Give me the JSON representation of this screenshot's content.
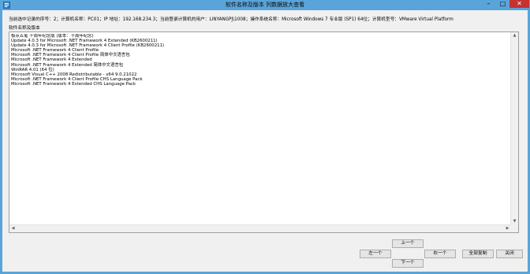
{
  "window": {
    "title": "软件名称及版本 列数据放大查看",
    "minimize_glyph": "–",
    "maximize_glyph": "□",
    "close_glyph": "✕"
  },
  "info_line": "当前选中记录的序号：2；计算机名称：PC01；IP 地址：192.168.234.3；当前登录计算机的用户：LINYANGPJ\\1008；操作系统名称：Microsoft Windows 7 专业版 (SP1) 64位；计算机型号：VMware Virtual Platform",
  "section_label": "软件名称及版本",
  "software_list": [
    "极点五笔 十周年纪念版 (版本：十周年纪念)",
    "Update 4.0.3 for Microsoft .NET Framework 4 Extended (KB2600211)",
    "Update 4.0.3 for Microsoft .NET Framework 4 Client Profile (KB2600211)",
    "Microsoft .NET Framework 4 Client Profile",
    "Microsoft .NET Framework 4 Client Profile 简体中文语言包",
    "Microsoft .NET Framework 4 Extended",
    "Microsoft .NET Framework 4 Extended 简体中文语言包",
    "WinRAR 4.01 (64 位)",
    "Microsoft Visual C++ 2008 Redistributable - x64 9.0.21022",
    "Microsoft .NET Framework 4 Client Profile CHS Language Pack",
    "Microsoft .NET Framework 4 Extended CHS Language Pack"
  ],
  "buttons": {
    "up": "上一个",
    "prev": "左一个",
    "next": "右一个",
    "down": "下一个",
    "copy_all": "全部复制",
    "close": "关闭"
  },
  "colors": {
    "titlebar": "#59a4d8",
    "close_button": "#c7312f",
    "client_bg": "#f0f0f0"
  }
}
